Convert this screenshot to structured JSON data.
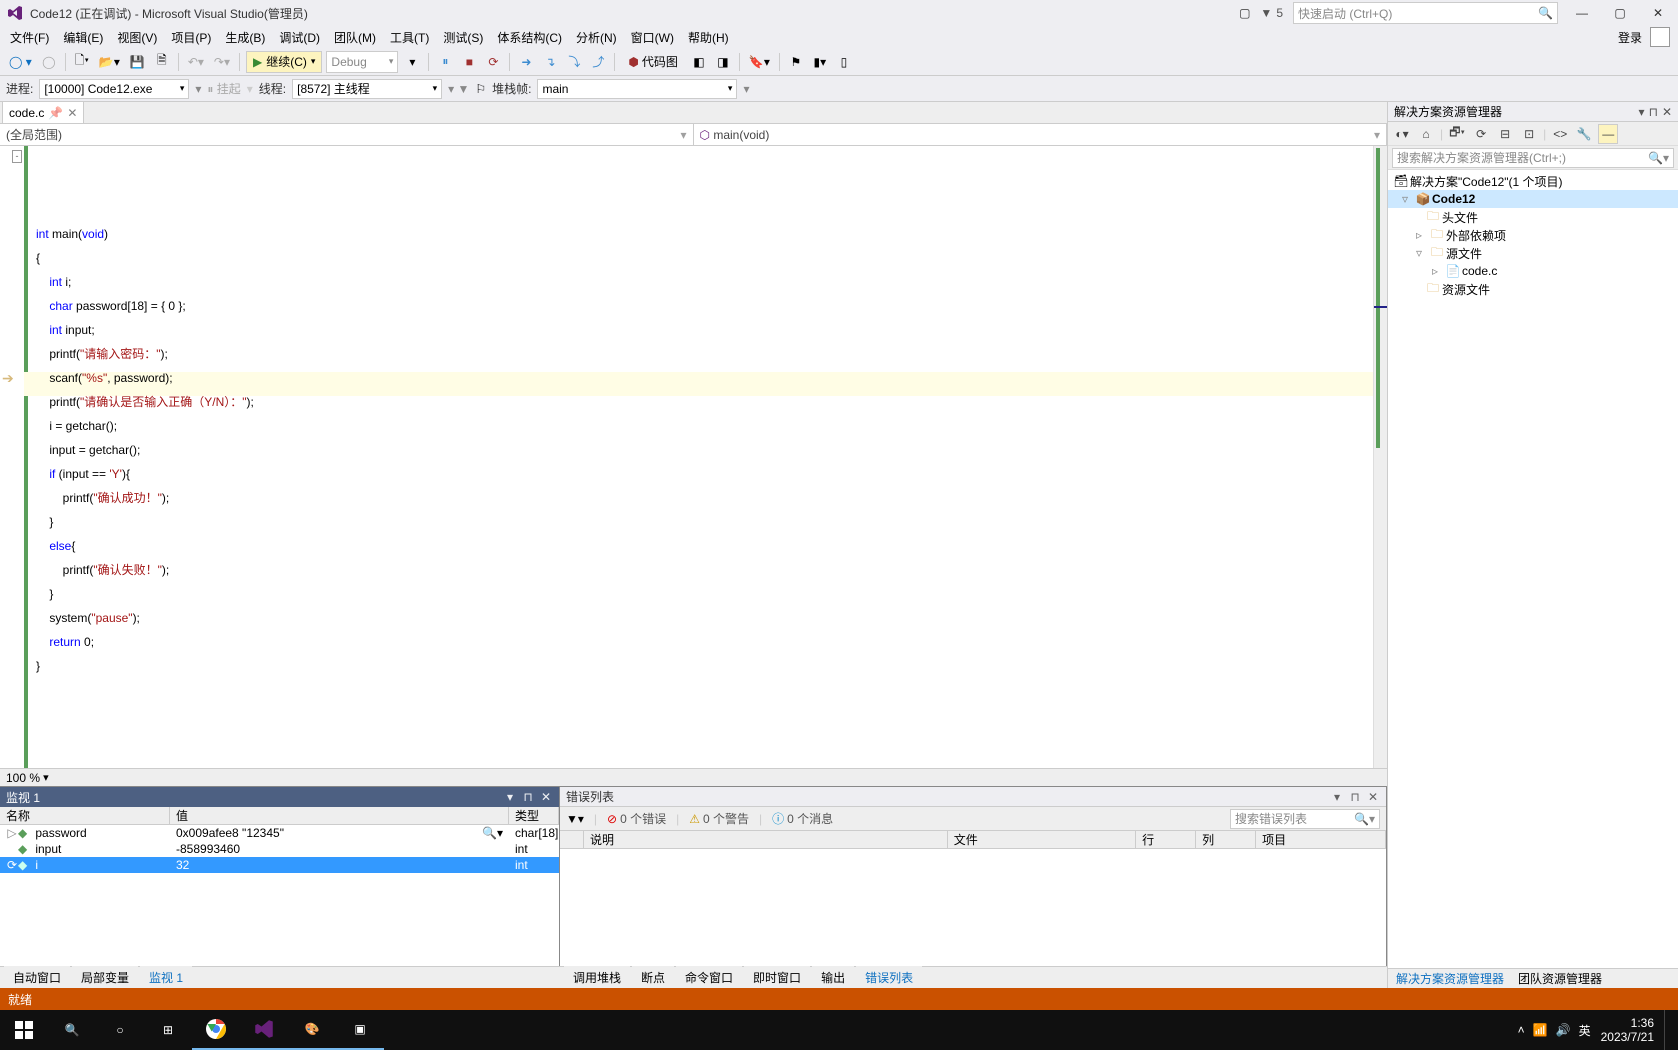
{
  "title_bar": {
    "app_title": "Code12 (正在调试) - Microsoft Visual Studio(管理员)",
    "notification_count": "5",
    "quicklaunch_placeholder": "快速启动 (Ctrl+Q)"
  },
  "menu": {
    "items": [
      "文件(F)",
      "编辑(E)",
      "视图(V)",
      "项目(P)",
      "生成(B)",
      "调试(D)",
      "团队(M)",
      "工具(T)",
      "测试(S)",
      "体系结构(C)",
      "分析(N)",
      "窗口(W)",
      "帮助(H)"
    ],
    "login": "登录"
  },
  "toolbar": {
    "continue": "继续(C)",
    "config": "Debug",
    "codemap": "代码图"
  },
  "toolbar2": {
    "process_label": "进程:",
    "process_value": "[10000] Code12.exe",
    "suspend": "挂起",
    "thread_label": "线程:",
    "thread_value": "[8572] 主线程",
    "stackframe_label": "堆栈帧:",
    "stackframe_value": "main"
  },
  "editor": {
    "file_tab": "code.c",
    "scope_left": "(全局范围)",
    "scope_right": "main(void)",
    "zoom": "100 %"
  },
  "code": {
    "l1a": "int",
    "l1b": " main(",
    "l1c": "void",
    "l1d": ")",
    "l2": "{",
    "l3a": "    ",
    "l3b": "int",
    "l3c": " i;",
    "l4a": "    ",
    "l4b": "char",
    "l4c": " password[18] = { 0 };",
    "l5a": "    ",
    "l5b": "int",
    "l5c": " input;",
    "l6a": "    printf(",
    "l6b": "\"请输入密码：\"",
    "l6c": ");",
    "l7a": "    scanf(",
    "l7b": "\"%s\"",
    "l7c": ", password);",
    "l8a": "    printf(",
    "l8b": "\"请确认是否输入正确（Y/N）：\"",
    "l8c": ");",
    "l9": "    i = getchar();",
    "l10": "    input = getchar();",
    "l11a": "    ",
    "l11b": "if",
    "l11c": " (input == ",
    "l11d": "'Y'",
    "l11e": "){",
    "l12a": "        printf(",
    "l12b": "\"确认成功！\"",
    "l12c": ");",
    "l13": "    }",
    "l14a": "    ",
    "l14b": "else",
    "l14c": "{",
    "l15a": "        printf(",
    "l15b": "\"确认失败！\"",
    "l15c": ");",
    "l16": "    }",
    "l17a": "    system(",
    "l17b": "\"pause\"",
    "l17c": ");",
    "l18a": "    ",
    "l18b": "return",
    "l18c": " 0;",
    "l19": "}"
  },
  "watch": {
    "title": "监视 1",
    "cols": {
      "name": "名称",
      "value": "值",
      "type": "类型"
    },
    "rows": [
      {
        "name": "password",
        "value": "0x009afee8 \"12345\"",
        "type": "char[18]"
      },
      {
        "name": "input",
        "value": "-858993460",
        "type": "int"
      },
      {
        "name": "i",
        "value": "32",
        "type": "int"
      }
    ]
  },
  "bottom_tabs_left": {
    "items": [
      "自动窗口",
      "局部变量",
      "监视 1"
    ],
    "active": 2
  },
  "errorlist": {
    "title": "错误列表",
    "errors": "0 个错误",
    "warnings": "0 个警告",
    "messages": "0 个消息",
    "search_placeholder": "搜索错误列表",
    "cols": {
      "desc": "说明",
      "file": "文件",
      "line": "行",
      "col": "列",
      "proj": "项目"
    }
  },
  "bottom_tabs_right": {
    "items": [
      "调用堆栈",
      "断点",
      "命令窗口",
      "即时窗口",
      "输出",
      "错误列表"
    ],
    "active": 5
  },
  "solution": {
    "title": "解决方案资源管理器",
    "search_placeholder": "搜索解决方案资源管理器(Ctrl+;)",
    "root": "解决方案\"Code12\"(1 个项目)",
    "project": "Code12",
    "folders": {
      "headers": "头文件",
      "external": "外部依赖项",
      "source": "源文件",
      "codec": "code.c",
      "resource": "资源文件"
    },
    "tabs": [
      "解决方案资源管理器",
      "团队资源管理器"
    ]
  },
  "status": {
    "text": "就绪"
  },
  "taskbar": {
    "ime": "英",
    "time": "1:36",
    "date": "2023/7/21"
  }
}
